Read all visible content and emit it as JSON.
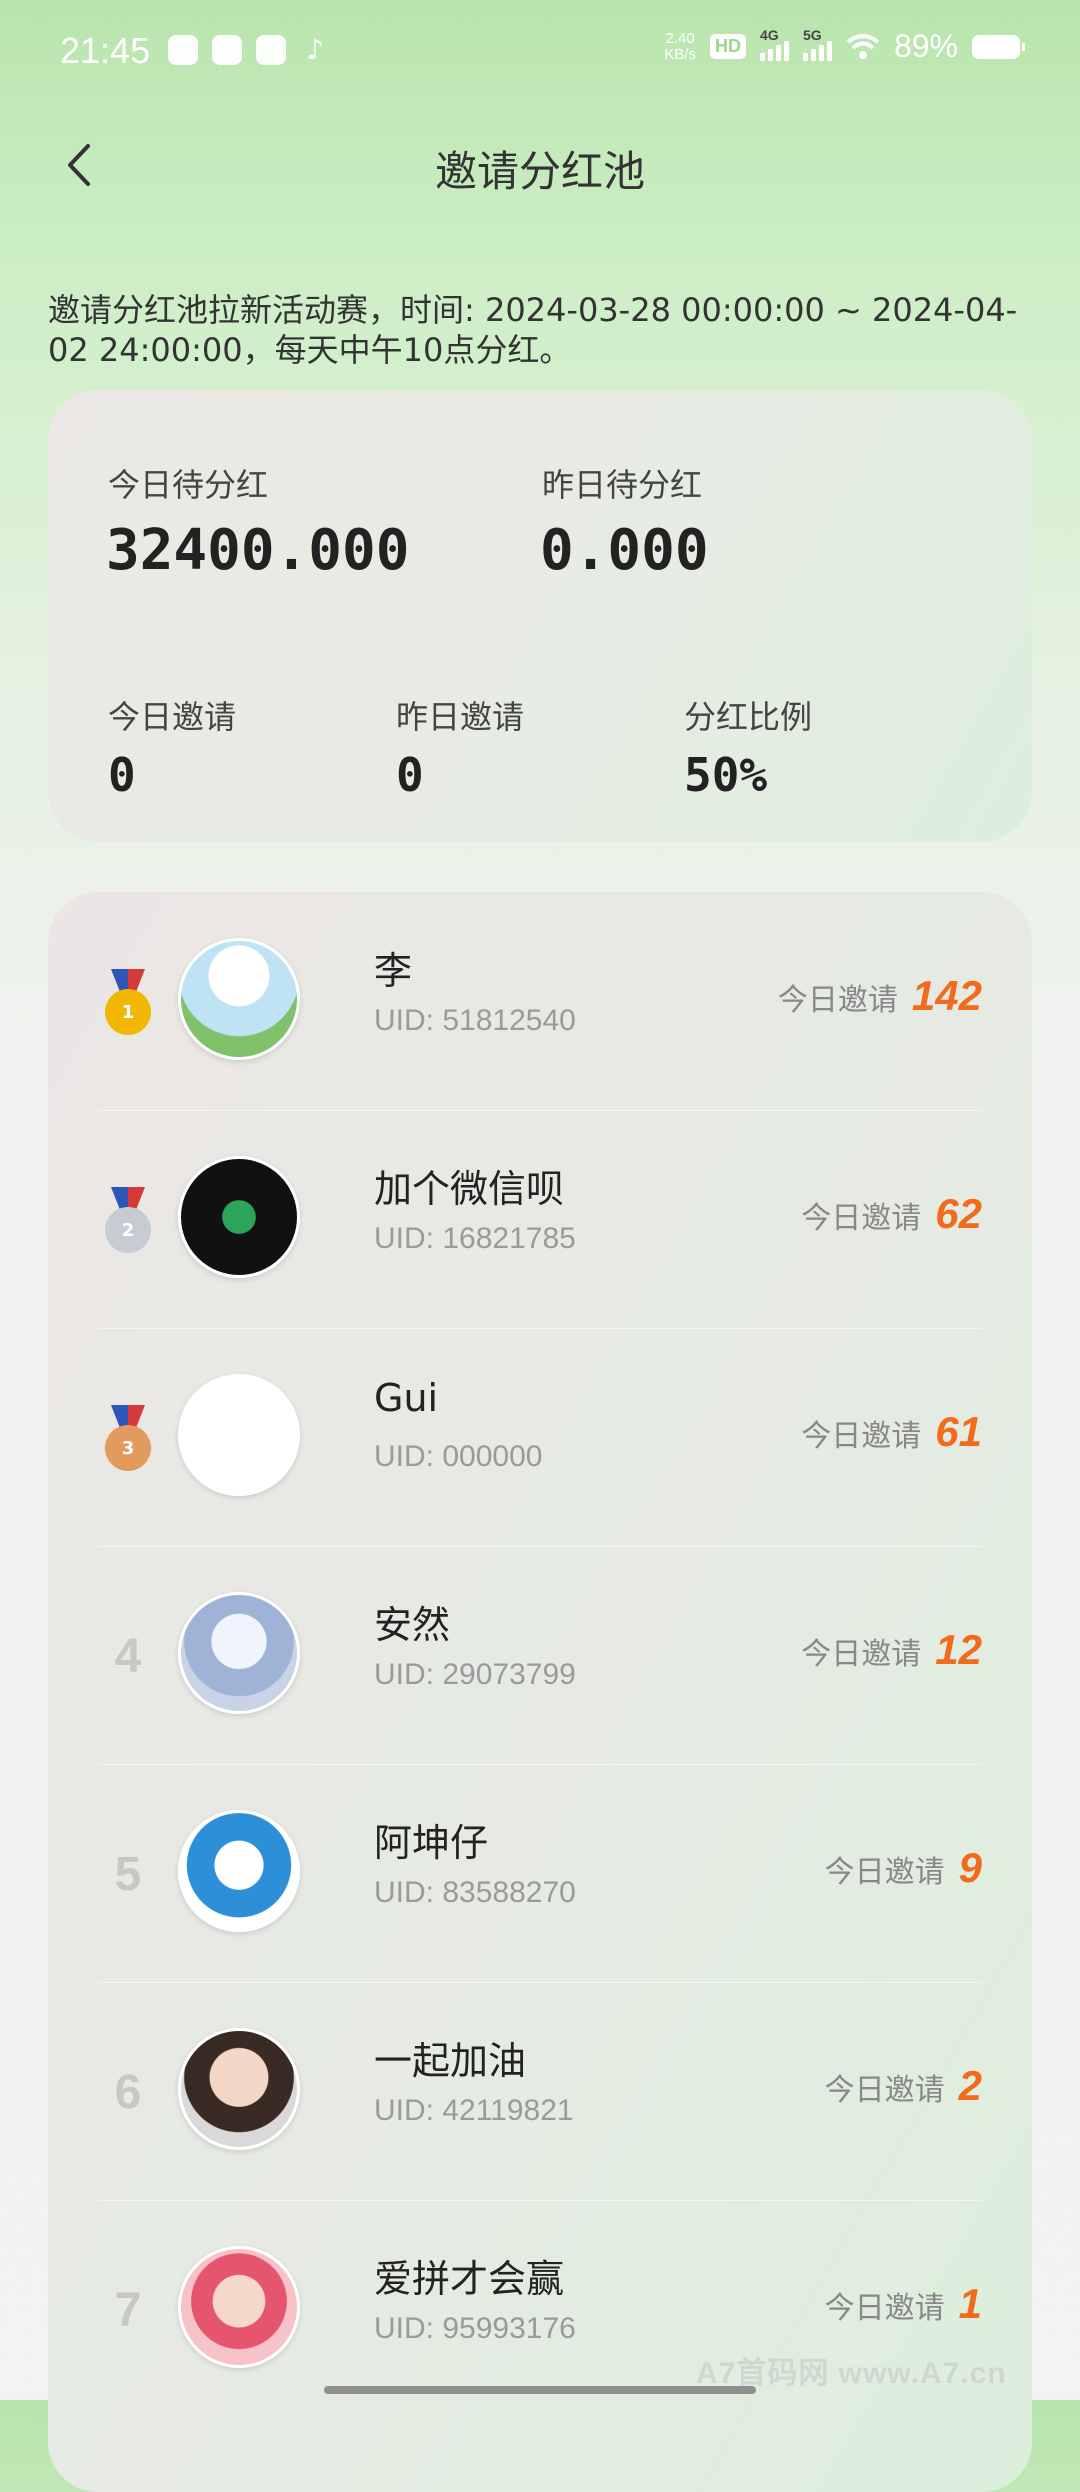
{
  "status_bar": {
    "time": "21:45",
    "net_speed_value": "2.40",
    "net_speed_unit": "KB/s",
    "hd_label": "HD",
    "sim1": "4G",
    "sim2": "5G",
    "battery": "89%"
  },
  "header": {
    "title": "邀请分红池"
  },
  "description": "邀请分红池拉新活动赛，时间: 2024-03-28 00:00:00 ~ 2024-04-02 24:00:00，每天中午10点分红。",
  "stats": {
    "today_pending_label": "今日待分红",
    "today_pending_value": "32400.000",
    "yesterday_pending_label": "昨日待分红",
    "yesterday_pending_value": "0.000",
    "today_invite_label": "今日邀请",
    "today_invite_value": "0",
    "yesterday_invite_label": "昨日邀请",
    "yesterday_invite_value": "0",
    "ratio_label": "分红比例",
    "ratio_value": "50%"
  },
  "ranking": [
    {
      "rank": "1",
      "name": "李",
      "uid": "UID: 51812540",
      "invite_label": "今日邀请",
      "invites": "142",
      "medal": "gold"
    },
    {
      "rank": "2",
      "name": "加个微信呗",
      "uid": "UID: 16821785",
      "invite_label": "今日邀请",
      "invites": "62",
      "medal": "silver"
    },
    {
      "rank": "3",
      "name": "Gui",
      "uid": "UID: 000000",
      "invite_label": "今日邀请",
      "invites": "61",
      "medal": "bronze"
    },
    {
      "rank": "4",
      "name": "安然",
      "uid": "UID: 29073799",
      "invite_label": "今日邀请",
      "invites": "12"
    },
    {
      "rank": "5",
      "name": "阿坤仔",
      "uid": "UID: 83588270",
      "invite_label": "今日邀请",
      "invites": "9"
    },
    {
      "rank": "6",
      "name": "一起加油",
      "uid": "UID: 42119821",
      "invite_label": "今日邀请",
      "invites": "2"
    },
    {
      "rank": "7",
      "name": "爱拼才会赢",
      "uid": "UID: 95993176",
      "invite_label": "今日邀请",
      "invites": "1"
    }
  ],
  "watermark": "A7首码网 www.A7.cn",
  "colors": {
    "accent": "#f26a1b",
    "gold": "#f2b705",
    "silver": "#c7ccd3",
    "bronze": "#e29a5e"
  }
}
